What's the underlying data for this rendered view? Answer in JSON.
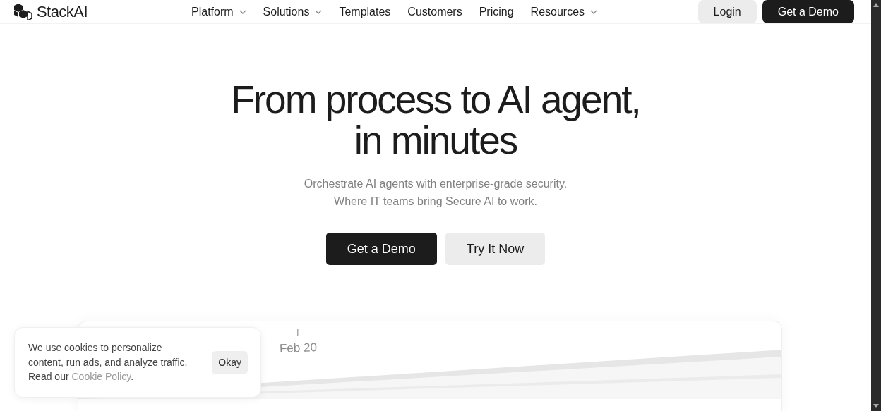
{
  "brand": {
    "name": "StackAI"
  },
  "nav": [
    {
      "label": "Platform",
      "has_menu": true
    },
    {
      "label": "Solutions",
      "has_menu": true
    },
    {
      "label": "Templates",
      "has_menu": false
    },
    {
      "label": "Customers",
      "has_menu": false
    },
    {
      "label": "Pricing",
      "has_menu": false
    },
    {
      "label": "Resources",
      "has_menu": true
    }
  ],
  "header_buttons": [
    {
      "label": "Login",
      "kind": "secondary"
    },
    {
      "label": "Get a Demo",
      "kind": "primary"
    }
  ],
  "hero": {
    "title_lines": [
      "From process to AI agent,",
      "in minutes"
    ],
    "subtitle_lines": [
      "Orchestrate AI agents with enterprise-grade security.",
      "Where IT teams bring Secure AI to work."
    ],
    "buttons": [
      {
        "label": "Get a Demo",
        "kind": "primary"
      },
      {
        "label": "Try It Now",
        "kind": "secondary"
      }
    ]
  },
  "preview": {
    "date_label": "Feb 20"
  },
  "cookie_banner": {
    "text_lines": [
      "We use cookies to personalize",
      "content, run ads, and analyze traffic."
    ],
    "lead": "Read our",
    "link": "Cookie Policy",
    "trail": ".",
    "button": "Okay"
  }
}
